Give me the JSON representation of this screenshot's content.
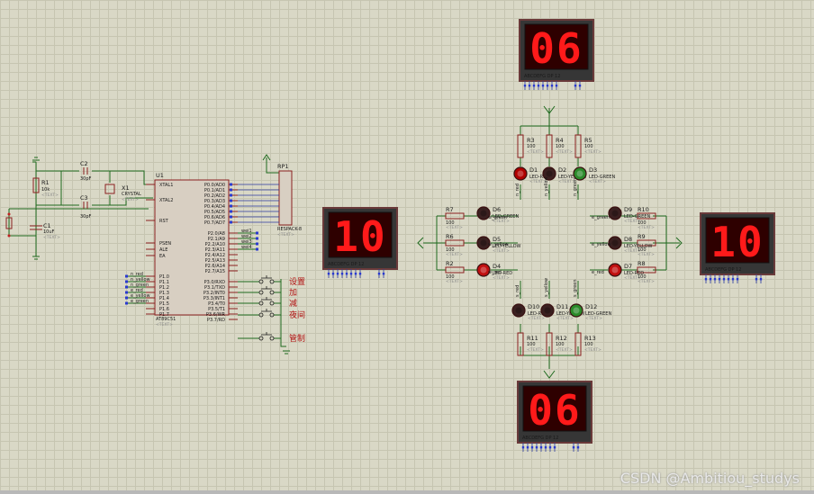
{
  "watermark": "CSDN @Ambitiou_studys",
  "displays": {
    "north": {
      "ref": "",
      "value": "06",
      "pins": "ABCDEFG  DP      12"
    },
    "south": {
      "ref": "",
      "value": "06",
      "pins": "ABCDEFG  DP      12"
    },
    "west": {
      "ref": "",
      "value": "10",
      "pins": "ABCDEFG  DP      12"
    },
    "east": {
      "ref": "",
      "value": "10",
      "pins": "ABCDEFG  DP      12"
    }
  },
  "mcu": {
    "ref": "U1",
    "part": "AT89C51",
    "text": "<TEXT>",
    "left_pins": [
      "XTAL1",
      "XTAL2",
      "RST",
      "PSEN",
      "ALE",
      "EA",
      "P1.0",
      "P1.1",
      "P1.2",
      "P1.3",
      "P1.4",
      "P1.5",
      "P1.6",
      "P1.7"
    ],
    "right_pins": [
      "P0.0/AD0",
      "P0.1/AD1",
      "P0.2/AD2",
      "P0.3/AD3",
      "P0.4/AD4",
      "P0.5/AD5",
      "P0.6/AD6",
      "P0.7/AD7",
      "P2.0/A8",
      "P2.1/A9",
      "P2.2/A10",
      "P2.3/A11",
      "P2.4/A12",
      "P2.5/A13",
      "P2.6/A14",
      "P2.7/A15",
      "P3.0/RXD",
      "P3.1/TXD",
      "P3.2/INT0",
      "P3.3/INT1",
      "P3.4/T0",
      "P3.5/T1",
      "P3.6/WR",
      "P3.7/RD"
    ]
  },
  "rp1": {
    "ref": "RP1",
    "part": "RESPACK-8",
    "text": "<TEXT>"
  },
  "c1": {
    "ref": "C1",
    "value": "10uF",
    "text": "<TEXT>"
  },
  "c2": {
    "ref": "C2",
    "value": "30pF",
    "text": "<TEXT>"
  },
  "c3": {
    "ref": "C3",
    "value": "30pF",
    "text": "<TEXT>"
  },
  "x1": {
    "ref": "X1",
    "value": "CRYSTAL",
    "text": "<TEXT>"
  },
  "r1": {
    "ref": "R1",
    "value": "10k",
    "text": "<TEXT>"
  },
  "buttons": [
    "设置",
    "加",
    "减",
    "夜间",
    "管制"
  ],
  "p1_nets": [
    "n_red",
    "n_yellow",
    "n_green",
    "e_red",
    "e_yellow",
    "e_green"
  ],
  "p2_nets": [
    "wei1",
    "wei2",
    "wei3",
    "wei4"
  ],
  "resistors": [
    {
      "ref": "R3",
      "value": "100"
    },
    {
      "ref": "R4",
      "value": "100"
    },
    {
      "ref": "R5",
      "value": "100"
    },
    {
      "ref": "R7",
      "value": "100"
    },
    {
      "ref": "R6",
      "value": "100"
    },
    {
      "ref": "R2",
      "value": "100"
    },
    {
      "ref": "R10",
      "value": "100"
    },
    {
      "ref": "R9",
      "value": "100"
    },
    {
      "ref": "R8",
      "value": "100"
    },
    {
      "ref": "R11",
      "value": "100"
    },
    {
      "ref": "R12",
      "value": "100"
    },
    {
      "ref": "R13",
      "value": "100"
    }
  ],
  "leds": [
    {
      "ref": "D1",
      "part": "LED-RED",
      "color": "#b00000",
      "lit": true
    },
    {
      "ref": "D2",
      "part": "LED-YELLOW",
      "color": "#3a2020",
      "lit": false
    },
    {
      "ref": "D3",
      "part": "LED-GREEN",
      "color": "#2a8a2a",
      "lit": true
    },
    {
      "ref": "D6",
      "part": "LED-GREEN",
      "color": "#3a2020",
      "lit": false
    },
    {
      "ref": "D5",
      "part": "LED-YELLOW",
      "color": "#3a2020",
      "lit": false
    },
    {
      "ref": "D4",
      "part": "LED-RED",
      "color": "#c01010",
      "lit": true
    },
    {
      "ref": "D9",
      "part": "LED-GREEN",
      "color": "#3a2020",
      "lit": false
    },
    {
      "ref": "D8",
      "part": "LED-YELLOW",
      "color": "#3a2020",
      "lit": false
    },
    {
      "ref": "D7",
      "part": "LED-RED",
      "color": "#c01010",
      "lit": true
    },
    {
      "ref": "D10",
      "part": "LED-RED",
      "color": "#3a2020",
      "lit": false
    },
    {
      "ref": "D11",
      "part": "LED-YELLOW",
      "color": "#3a2020",
      "lit": false
    },
    {
      "ref": "D12",
      "part": "LED-GREEN",
      "color": "#2a8a2a",
      "lit": true
    }
  ],
  "led_nets": {
    "west": [
      "w_green",
      "w_yellow",
      "w_red"
    ],
    "east": [
      "e_green",
      "e_yellow",
      "e_red"
    ],
    "north": [
      "n_red",
      "n_yellow",
      "n_green"
    ],
    "south": [
      "s_red",
      "s_yellow",
      "s_green"
    ]
  },
  "text_placeholder": "<TEXT>"
}
